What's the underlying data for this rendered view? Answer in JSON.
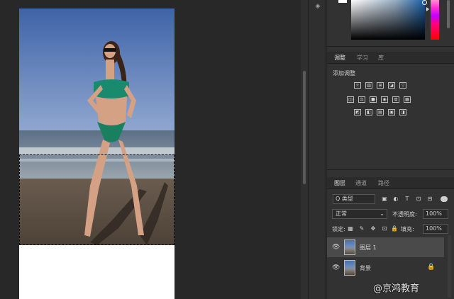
{
  "adjustments": {
    "tabs": [
      "调整",
      "学习",
      "库"
    ],
    "title": "添加调整",
    "row1": [
      "☼",
      "▥",
      "⊞",
      "◪",
      "▽"
    ],
    "row2": [
      "◫",
      "⚖",
      "■",
      "◉",
      "✿",
      "▦"
    ],
    "row3": [
      "◩",
      "◧",
      "▤",
      "▣",
      "◨"
    ]
  },
  "layers": {
    "tabs": [
      "图层",
      "通道",
      "路径"
    ],
    "filter_label": "Q 类型",
    "filter_icons": [
      "▣",
      "◐",
      "T",
      "⊡",
      "⊟"
    ],
    "blend_mode": "正常",
    "opacity_label": "不透明度:",
    "opacity_value": "100%",
    "lock_label": "锁定:",
    "lock_icons": [
      "▦",
      "✎",
      "✥",
      "⊡",
      "🔒"
    ],
    "fill_label": "填充:",
    "fill_value": "100%",
    "items": [
      {
        "name": "图层 1",
        "visible": true,
        "selected": true
      },
      {
        "name": "背景",
        "visible": true,
        "locked": true
      }
    ]
  },
  "watermark": "@京鸿教育"
}
